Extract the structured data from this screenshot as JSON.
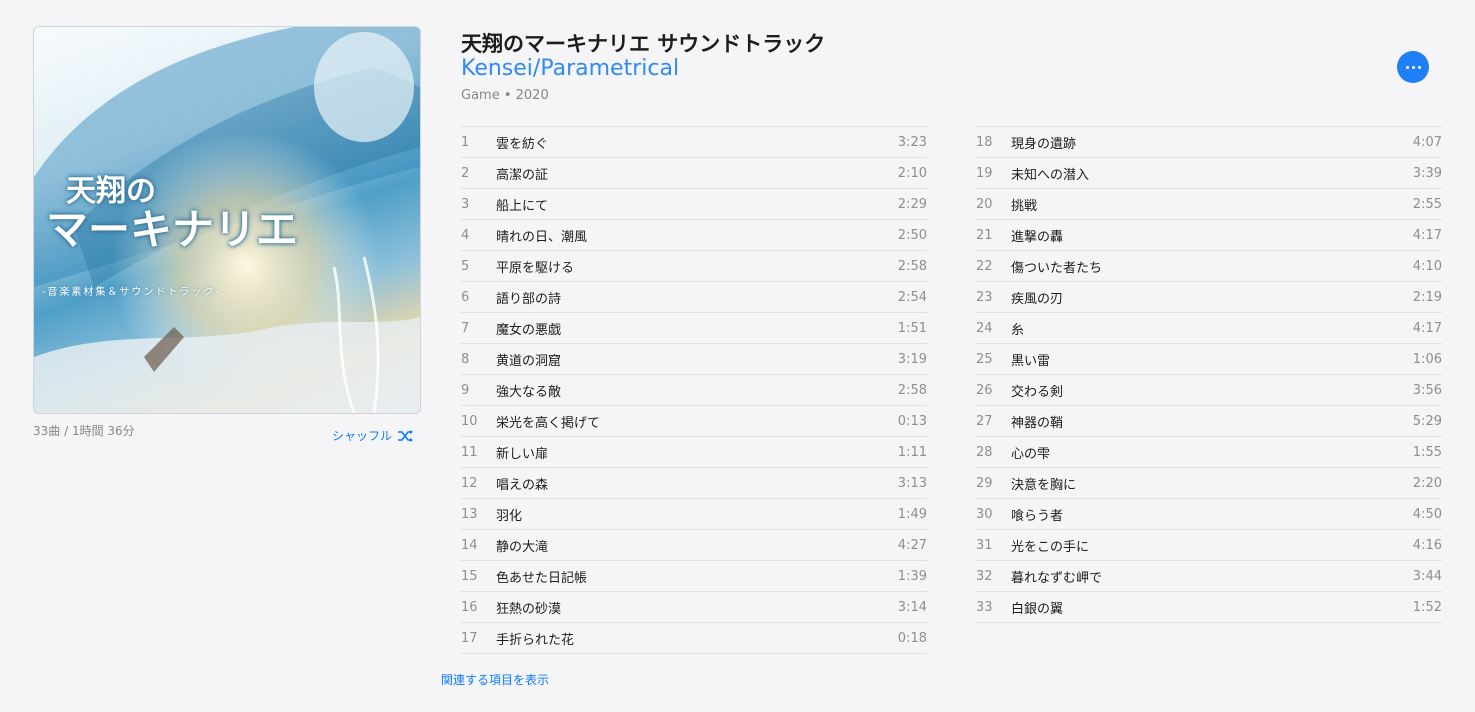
{
  "album": {
    "title": "天翔のマーキナリエ サウンドトラック",
    "artist": "Kensei/Parametrical",
    "genre_year": "Game • 2020",
    "art_title_line1": "天翔の",
    "art_title_line2": "マーキナリエ",
    "art_subtitle": "-音楽素材集＆サウンドトラック-"
  },
  "summary": "33曲 / 1時間 36分",
  "shuffle_label": "シャッフル",
  "related_label": "関連する項目を表示",
  "accent_color": "#0a7aff",
  "icons": {
    "more": "ellipsis-icon",
    "shuffle": "shuffle-icon"
  },
  "tracks": [
    {
      "num": "1",
      "name": "雲を紡ぐ",
      "dur": "3:23"
    },
    {
      "num": "2",
      "name": "高潔の証",
      "dur": "2:10"
    },
    {
      "num": "3",
      "name": "船上にて",
      "dur": "2:29"
    },
    {
      "num": "4",
      "name": "晴れの日、潮風",
      "dur": "2:50"
    },
    {
      "num": "5",
      "name": "平原を駆ける",
      "dur": "2:58"
    },
    {
      "num": "6",
      "name": "語り部の詩",
      "dur": "2:54"
    },
    {
      "num": "7",
      "name": "魔女の悪戯",
      "dur": "1:51"
    },
    {
      "num": "8",
      "name": "黄道の洞窟",
      "dur": "3:19"
    },
    {
      "num": "9",
      "name": "強大なる敵",
      "dur": "2:58"
    },
    {
      "num": "10",
      "name": "栄光を高く掲げて",
      "dur": "0:13"
    },
    {
      "num": "11",
      "name": "新しい扉",
      "dur": "1:11"
    },
    {
      "num": "12",
      "name": "唱えの森",
      "dur": "3:13"
    },
    {
      "num": "13",
      "name": "羽化",
      "dur": "1:49"
    },
    {
      "num": "14",
      "name": "静の大滝",
      "dur": "4:27"
    },
    {
      "num": "15",
      "name": "色あせた日記帳",
      "dur": "1:39"
    },
    {
      "num": "16",
      "name": "狂熱の砂漠",
      "dur": "3:14"
    },
    {
      "num": "17",
      "name": "手折られた花",
      "dur": "0:18"
    },
    {
      "num": "18",
      "name": "現身の遺跡",
      "dur": "4:07"
    },
    {
      "num": "19",
      "name": "未知への潜入",
      "dur": "3:39"
    },
    {
      "num": "20",
      "name": "挑戦",
      "dur": "2:55"
    },
    {
      "num": "21",
      "name": "進撃の轟",
      "dur": "4:17"
    },
    {
      "num": "22",
      "name": "傷ついた者たち",
      "dur": "4:10"
    },
    {
      "num": "23",
      "name": "疾風の刃",
      "dur": "2:19"
    },
    {
      "num": "24",
      "name": "糸",
      "dur": "4:17"
    },
    {
      "num": "25",
      "name": "黒い雷",
      "dur": "1:06"
    },
    {
      "num": "26",
      "name": "交わる剣",
      "dur": "3:56"
    },
    {
      "num": "27",
      "name": "神器の鞘",
      "dur": "5:29"
    },
    {
      "num": "28",
      "name": "心の雫",
      "dur": "1:55"
    },
    {
      "num": "29",
      "name": "決意を胸に",
      "dur": "2:20"
    },
    {
      "num": "30",
      "name": "喰らう者",
      "dur": "4:50"
    },
    {
      "num": "31",
      "name": "光をこの手に",
      "dur": "4:16"
    },
    {
      "num": "32",
      "name": "暮れなずむ岬で",
      "dur": "3:44"
    },
    {
      "num": "33",
      "name": "白銀の翼",
      "dur": "1:52"
    }
  ]
}
